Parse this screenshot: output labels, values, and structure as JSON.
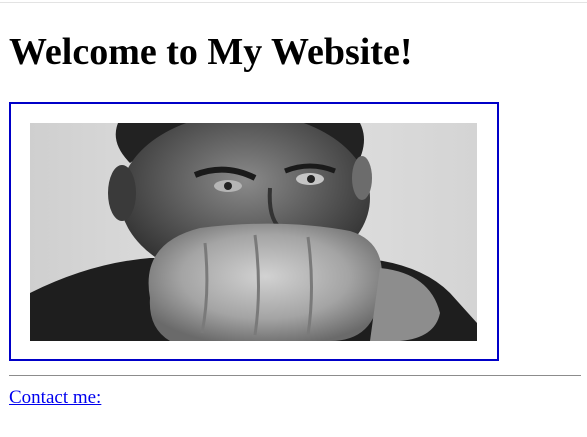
{
  "page": {
    "heading": "Welcome to My Website!",
    "contact_link": "Contact me:"
  },
  "image": {
    "subject": "black-and-white photo of man with raised fist",
    "frame_color": "#0000c8"
  },
  "colors": {
    "link": "#0000ee",
    "frame_border": "#0000c8",
    "divider": "#8c8c8c",
    "background": "#ffffff"
  }
}
